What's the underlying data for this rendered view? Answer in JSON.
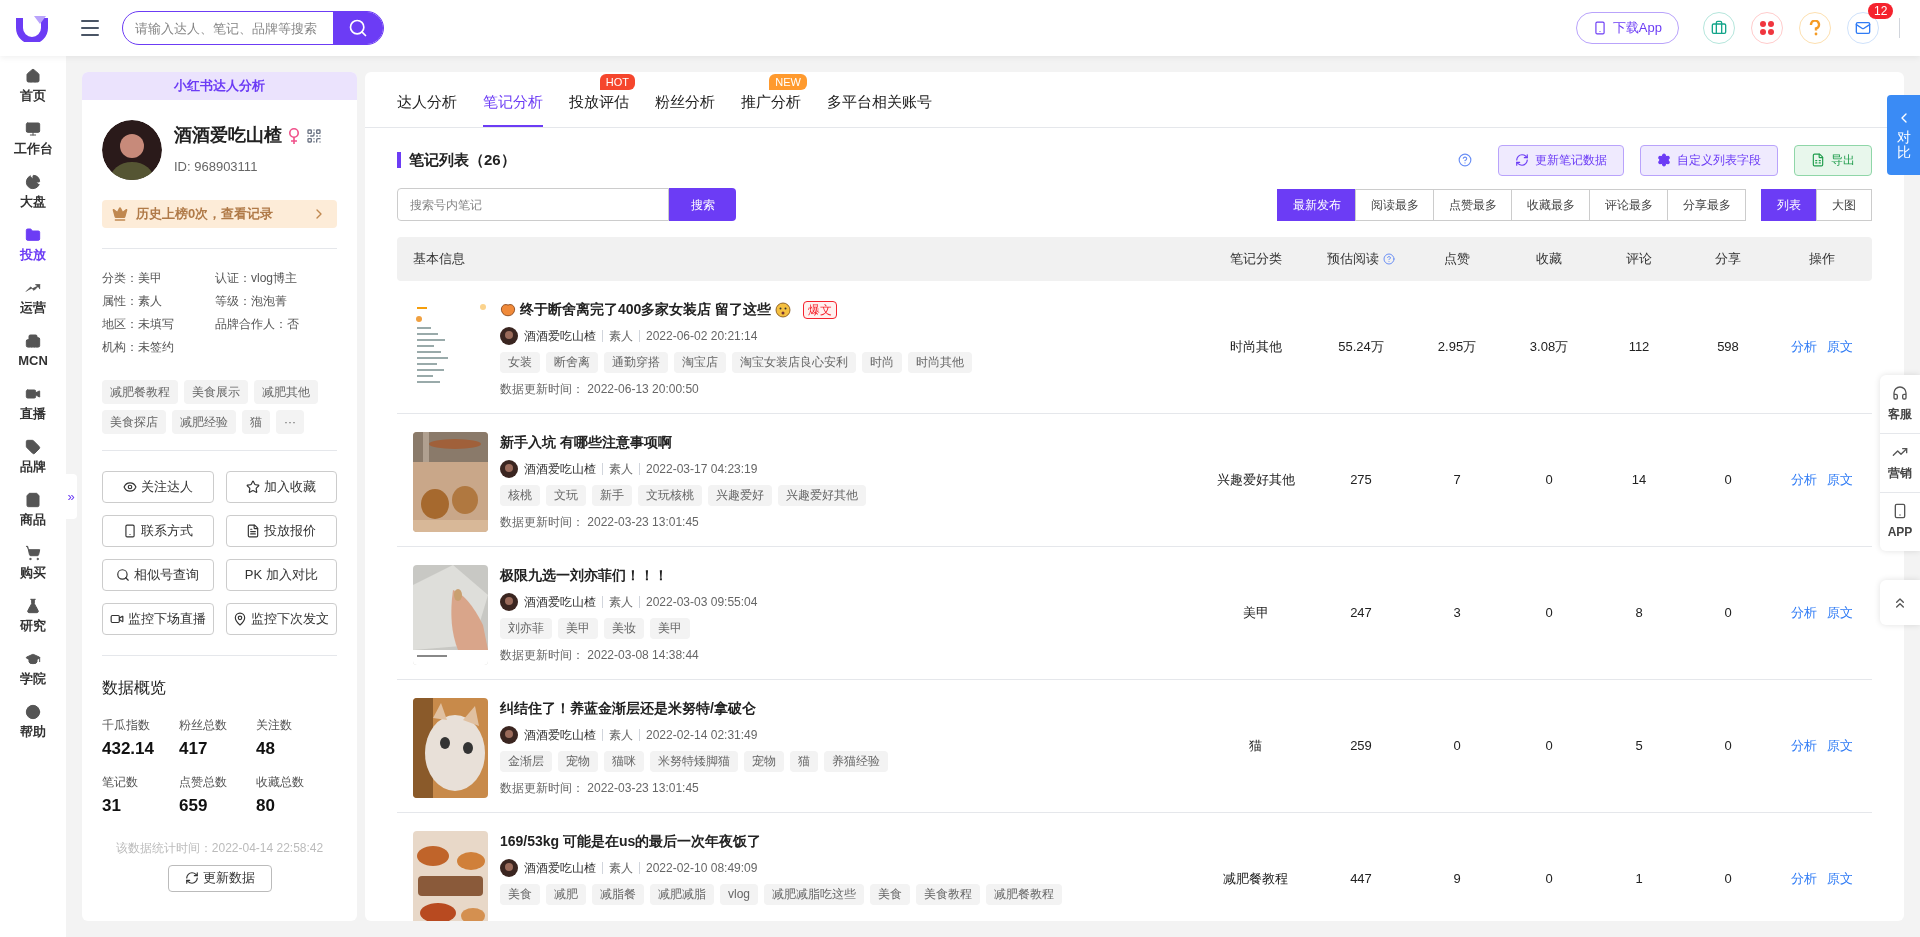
{
  "top_bar": {
    "search": {
      "placeholder": "请输入达人、笔记、品牌等搜索"
    },
    "download_button": "下载App",
    "message_badge": "12"
  },
  "nav": {
    "items": [
      {
        "label": "首页",
        "selected": false
      },
      {
        "label": "工作台",
        "selected": false
      },
      {
        "label": "大盘",
        "selected": false
      },
      {
        "label": "投放",
        "selected": true
      },
      {
        "label": "运营",
        "selected": false
      },
      {
        "label": "MCN",
        "selected": false
      },
      {
        "label": "直播",
        "selected": false
      },
      {
        "label": "品牌",
        "selected": false
      },
      {
        "label": "商品",
        "selected": false
      },
      {
        "label": "购买",
        "selected": false
      },
      {
        "label": "研究",
        "selected": false
      },
      {
        "label": "学院",
        "selected": false
      },
      {
        "label": "帮助",
        "selected": false
      }
    ]
  },
  "collapse_toggle": "»",
  "profile": {
    "header": "小红书达人分析",
    "name": "酒酒爱吃山楂",
    "id": "ID:  968903111",
    "history": "历史上榜0次，查看记录",
    "attributes": [
      "分类：美甲",
      "认证：vlog博主",
      "属性：素人",
      "等级：泡泡菁",
      "地区：未填写",
      "品牌合作人：否",
      "机构：未签约"
    ],
    "tags": [
      "减肥餐教程",
      "美食展示",
      "减肥其他",
      "美食探店",
      "减肥经验",
      "猫",
      "···"
    ],
    "actions": [
      "关注达人",
      "加入收藏",
      "联系方式",
      "投放报价",
      "相似号查询",
      "PK 加入对比",
      "监控下场直播",
      "监控下次发文"
    ],
    "overview_title": "数据概览",
    "stats": [
      {
        "label": "千瓜指数",
        "value": "432.14"
      },
      {
        "label": "粉丝总数",
        "value": "417"
      },
      {
        "label": "关注数",
        "value": "48"
      },
      {
        "label": "笔记数",
        "value": "31"
      },
      {
        "label": "点赞总数",
        "value": "659"
      },
      {
        "label": "收藏总数",
        "value": "80"
      }
    ],
    "stat_time": "该数据统计时间：2022-04-14 22:58:42",
    "refresh_button": "更新数据"
  },
  "tabs": [
    {
      "label": "达人分析",
      "selected": false
    },
    {
      "label": "笔记分析",
      "selected": true
    },
    {
      "label": "投放评估",
      "selected": false,
      "badge": {
        "text": "HOT",
        "color": "#f5462d"
      }
    },
    {
      "label": "粉丝分析",
      "selected": false
    },
    {
      "label": "推广分析",
      "selected": false,
      "badge": {
        "text": "NEW",
        "color": "#ff9a2e"
      }
    },
    {
      "label": "多平台相关账号",
      "selected": false
    }
  ],
  "notes": {
    "title": "笔记列表（26）",
    "buttons": [
      "更新笔记数据",
      "自定义列表字段",
      "导出"
    ],
    "search": {
      "placeholder": "搜索号内笔记",
      "button": "搜索"
    },
    "sorts": [
      {
        "label": "最新发布",
        "selected": true
      },
      {
        "label": "阅读最多",
        "selected": false
      },
      {
        "label": "点赞最多",
        "selected": false
      },
      {
        "label": "收藏最多",
        "selected": false
      },
      {
        "label": "评论最多",
        "selected": false
      },
      {
        "label": "分享最多",
        "selected": false
      }
    ],
    "views": [
      {
        "label": "列表",
        "selected": true
      },
      {
        "label": "大图",
        "selected": false
      }
    ],
    "columns": [
      "基本信息",
      "笔记分类",
      "预估阅读",
      "点赞",
      "收藏",
      "评论",
      "分享",
      "操作"
    ],
    "rows": [
      {
        "title": "终于断舍离完了400多家女装店 留了这些",
        "emoji_before": true,
        "emoji_after": true,
        "badge": "爆文",
        "author": "酒酒爱吃山楂",
        "author_type": "素人",
        "published": "2022-06-02 20:21:14",
        "tags": [
          "女装",
          "断舍离",
          "通勤穿搭",
          "淘宝店",
          "淘宝女装店良心安利",
          "时尚",
          "时尚其他"
        ],
        "updated_label": "数据更新时间：",
        "updated": "2022-06-13 20:00:50",
        "category": "时尚其他",
        "reads": "55.24万",
        "likes": "2.95万",
        "saves": "3.08万",
        "comments": "112",
        "shares": "598",
        "actions": [
          "分析",
          "原文"
        ]
      },
      {
        "title": "新手入坑 有哪些注意事项啊",
        "emoji_before": false,
        "emoji_after": false,
        "author": "酒酒爱吃山楂",
        "author_type": "素人",
        "published": "2022-03-17 04:23:19",
        "tags": [
          "核桃",
          "文玩",
          "新手",
          "文玩核桃",
          "兴趣爱好",
          "兴趣爱好其他"
        ],
        "updated_label": "数据更新时间：",
        "updated": "2022-03-23 13:01:45",
        "category": "兴趣爱好其他",
        "reads": "275",
        "likes": "7",
        "saves": "0",
        "comments": "14",
        "shares": "0",
        "actions": [
          "分析",
          "原文"
        ]
      },
      {
        "title": "极限九选一刘亦菲们！！！",
        "emoji_before": false,
        "emoji_after": false,
        "author": "酒酒爱吃山楂",
        "author_type": "素人",
        "published": "2022-03-03 09:55:04",
        "tags": [
          "刘亦菲",
          "美甲",
          "美妆",
          "美甲"
        ],
        "updated_label": "数据更新时间：",
        "updated": "2022-03-08 14:38:44",
        "category": "美甲",
        "reads": "247",
        "likes": "3",
        "saves": "0",
        "comments": "8",
        "shares": "0",
        "actions": [
          "分析",
          "原文"
        ]
      },
      {
        "title": "纠结住了！养蓝金渐层还是米努特/拿破仑",
        "emoji_before": false,
        "emoji_after": false,
        "author": "酒酒爱吃山楂",
        "author_type": "素人",
        "published": "2022-02-14 02:31:49",
        "tags": [
          "金渐层",
          "宠物",
          "猫咪",
          "米努特矮脚猫",
          "宠物",
          "猫",
          "养猫经验"
        ],
        "updated_label": "数据更新时间：",
        "updated": "2022-03-23 13:01:45",
        "category": "猫",
        "reads": "259",
        "likes": "0",
        "saves": "0",
        "comments": "5",
        "shares": "0",
        "actions": [
          "分析",
          "原文"
        ]
      },
      {
        "title": "169/53kg 可能是在us的最后一次年夜饭了",
        "emoji_before": false,
        "emoji_after": false,
        "author": "酒酒爱吃山楂",
        "author_type": "素人",
        "published": "2022-02-10 08:49:09",
        "tags": [
          "美食",
          "减肥",
          "减脂餐",
          "减肥减脂",
          "vlog",
          "减肥减脂吃这些",
          "美食",
          "美食教程",
          "减肥餐教程"
        ],
        "category": "减肥餐教程",
        "reads": "447",
        "likes": "9",
        "saves": "0",
        "comments": "1",
        "shares": "0",
        "actions": [
          "分析",
          "原文"
        ]
      }
    ]
  },
  "compare_tab": {
    "label": "对比"
  },
  "side_tools": [
    "客服",
    "营销",
    "APP"
  ]
}
